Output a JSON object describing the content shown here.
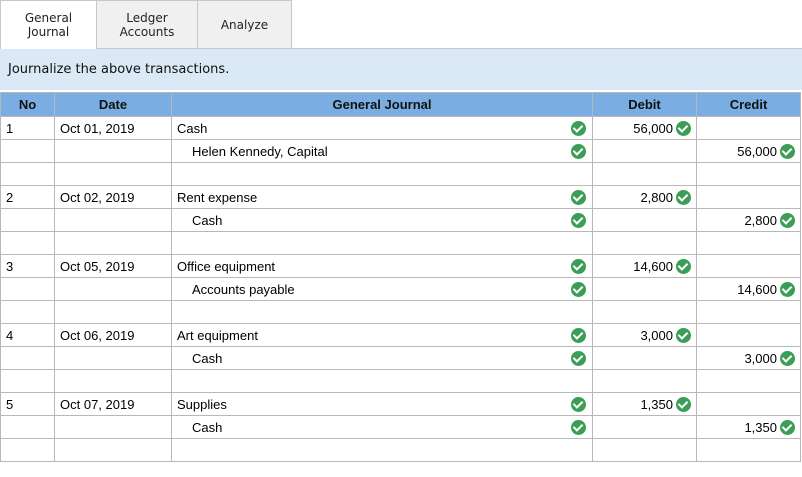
{
  "tabs": [
    {
      "label": "General\nJournal",
      "active": true
    },
    {
      "label": "Ledger\nAccounts",
      "active": false
    },
    {
      "label": "Analyze",
      "active": false
    }
  ],
  "instruction": "Journalize the above transactions.",
  "table": {
    "headers": [
      "No",
      "Date",
      "General Journal",
      "Debit",
      "Credit"
    ],
    "rows": [
      {
        "no": "1",
        "date": "Oct 01, 2019",
        "account": "Cash",
        "indent": false,
        "debit": "56,000",
        "credit": "",
        "checked": true
      },
      {
        "no": "",
        "date": "",
        "account": "Helen Kennedy, Capital",
        "indent": true,
        "debit": "",
        "credit": "56,000",
        "checked": true
      },
      {
        "no": "",
        "date": "",
        "account": "",
        "indent": false,
        "debit": "",
        "credit": "",
        "checked": false
      },
      {
        "no": "2",
        "date": "Oct 02, 2019",
        "account": "Rent expense",
        "indent": false,
        "debit": "2,800",
        "credit": "",
        "checked": true
      },
      {
        "no": "",
        "date": "",
        "account": "Cash",
        "indent": true,
        "debit": "",
        "credit": "2,800",
        "checked": true
      },
      {
        "no": "",
        "date": "",
        "account": "",
        "indent": false,
        "debit": "",
        "credit": "",
        "checked": false
      },
      {
        "no": "3",
        "date": "Oct 05, 2019",
        "account": "Office equipment",
        "indent": false,
        "debit": "14,600",
        "credit": "",
        "checked": true
      },
      {
        "no": "",
        "date": "",
        "account": "Accounts payable",
        "indent": true,
        "debit": "",
        "credit": "14,600",
        "checked": true
      },
      {
        "no": "",
        "date": "",
        "account": "",
        "indent": false,
        "debit": "",
        "credit": "",
        "checked": false
      },
      {
        "no": "4",
        "date": "Oct 06, 2019",
        "account": "Art equipment",
        "indent": false,
        "debit": "3,000",
        "credit": "",
        "checked": true
      },
      {
        "no": "",
        "date": "",
        "account": "Cash",
        "indent": true,
        "debit": "",
        "credit": "3,000",
        "checked": true
      },
      {
        "no": "",
        "date": "",
        "account": "",
        "indent": false,
        "debit": "",
        "credit": "",
        "checked": false
      },
      {
        "no": "5",
        "date": "Oct 07, 2019",
        "account": "Supplies",
        "indent": false,
        "debit": "1,350",
        "credit": "",
        "checked": true
      },
      {
        "no": "",
        "date": "",
        "account": "Cash",
        "indent": true,
        "debit": "",
        "credit": "1,350",
        "checked": true
      },
      {
        "no": "",
        "date": "",
        "account": "",
        "indent": false,
        "debit": "",
        "credit": "",
        "checked": false
      }
    ]
  },
  "icons": {
    "check": "check-circle-icon"
  },
  "colors": {
    "header_bg": "#7aaee3",
    "instruction_bg": "#dbe9f7",
    "check": "#3b9e56"
  }
}
